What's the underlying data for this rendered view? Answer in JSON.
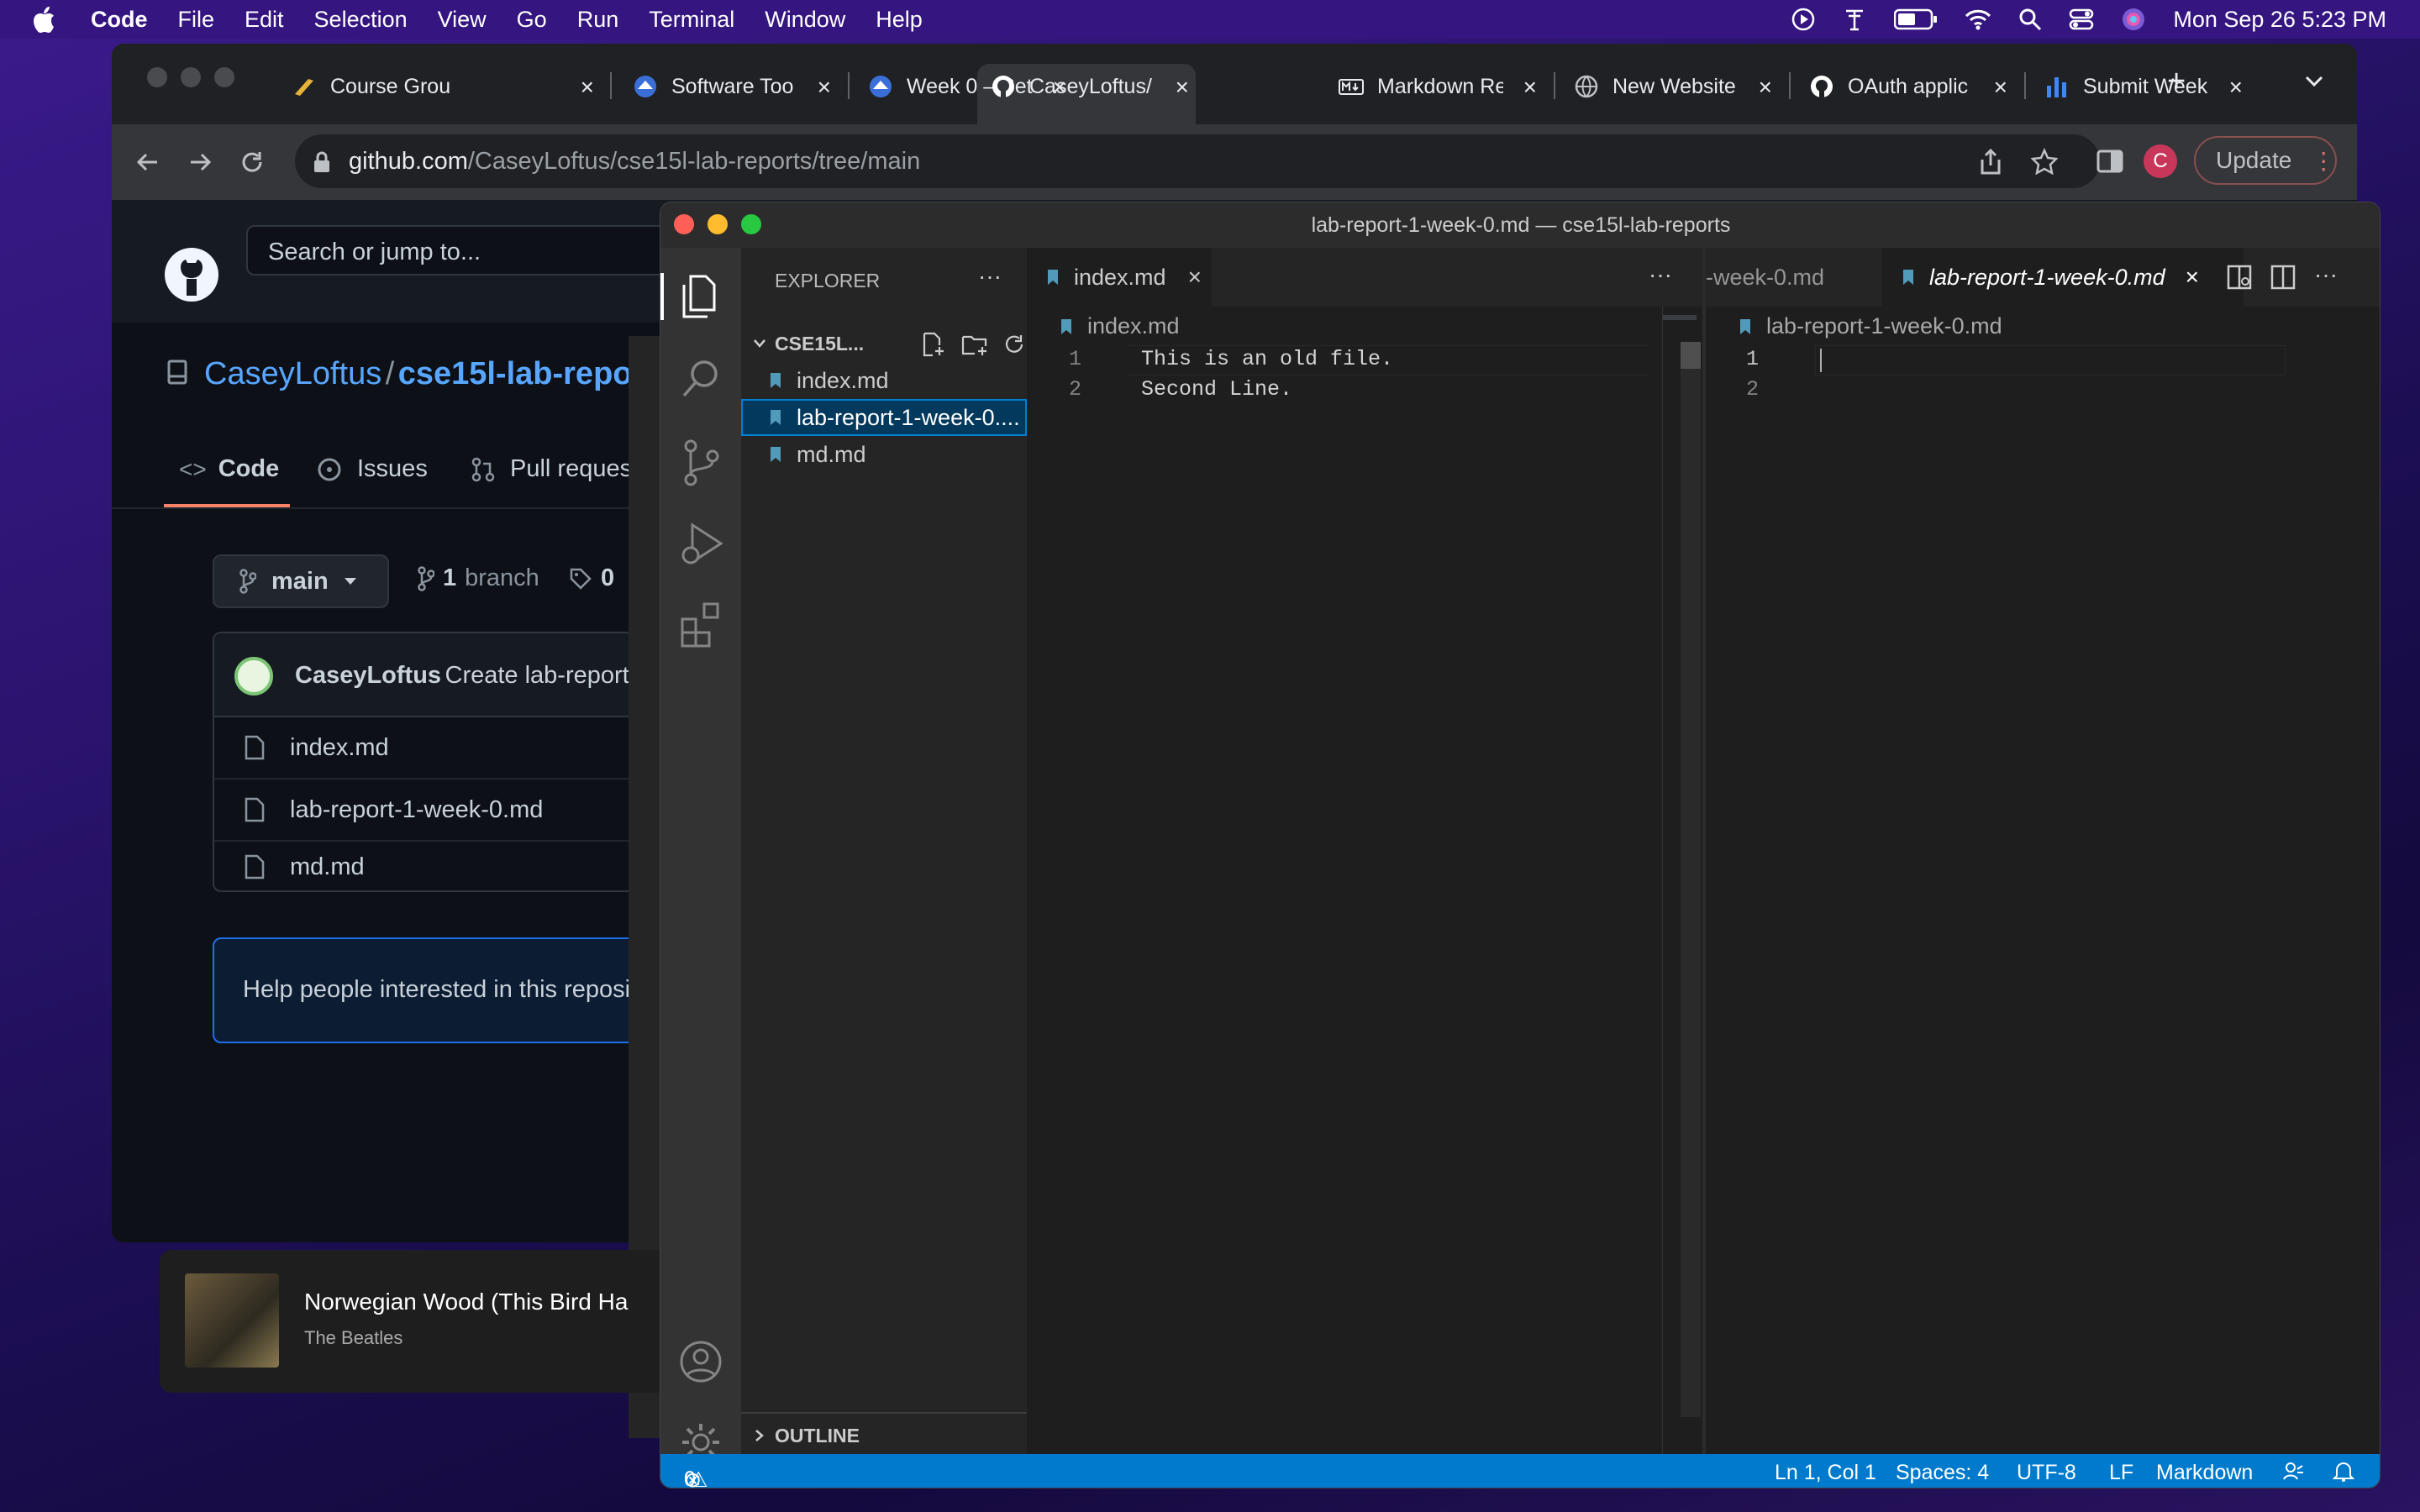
{
  "menubar": {
    "app": "Code",
    "items": [
      "File",
      "Edit",
      "Selection",
      "View",
      "Go",
      "Run",
      "Terminal",
      "Window",
      "Help"
    ],
    "clock": "Mon Sep 26  5:23 PM"
  },
  "browser": {
    "tabs": [
      {
        "label": "Course Grou"
      },
      {
        "label": "Software Too"
      },
      {
        "label": "Week 0 – Set"
      },
      {
        "label": "CaseyLoftus/"
      },
      {
        "label": "Markdown Re"
      },
      {
        "label": "New Website"
      },
      {
        "label": "OAuth applic"
      },
      {
        "label": "Submit Week"
      }
    ],
    "url_host": "github.com",
    "url_path": "/CaseyLoftus/cse15l-lab-reports/tree/main",
    "profile_letter": "C",
    "update_label": "Update"
  },
  "github": {
    "search_placeholder": "Search or jump to...",
    "owner": "CaseyLoftus",
    "sep": "/",
    "repo": "cse15l-lab-repo",
    "nav": {
      "code": "Code",
      "issues": "Issues",
      "pulls": "Pull reques"
    },
    "branch": "main",
    "branch_count": "1",
    "branch_word": "branch",
    "tags_count": "0",
    "commit_author": "CaseyLoftus",
    "commit_msg": "Create lab-report",
    "files": [
      "index.md",
      "lab-report-1-week-0.md",
      "md.md"
    ],
    "help_text": "Help people interested in this reposi"
  },
  "music": {
    "title": "Norwegian Wood (This Bird Ha",
    "artist": "The Beatles"
  },
  "vscode": {
    "window_title": "lab-report-1-week-0.md — cse15l-lab-reports",
    "explorer_title": "EXPLORER",
    "folder": "CSE15L...",
    "files": [
      "index.md",
      "lab-report-1-week-0....",
      "md.md"
    ],
    "outline": "OUTLINE",
    "left_tab": "index.md",
    "left_crumb": "index.md",
    "left_lines": [
      "This is an old file.",
      "Second Line."
    ],
    "right_tab_partial": "-week-0.md",
    "right_tab": "lab-report-1-week-0.md",
    "right_crumb": "lab-report-1-week-0.md",
    "right_line_numbers": [
      "1",
      "2"
    ],
    "status": {
      "errors": "0",
      "warnings": "0",
      "position": "Ln 1, Col 1",
      "spaces": "Spaces: 4",
      "encoding": "UTF-8",
      "eol": "LF",
      "language": "Markdown"
    }
  },
  "colors": {
    "accent": "#007acc",
    "selection": "#04395e",
    "github_link": "#58a6ff"
  }
}
